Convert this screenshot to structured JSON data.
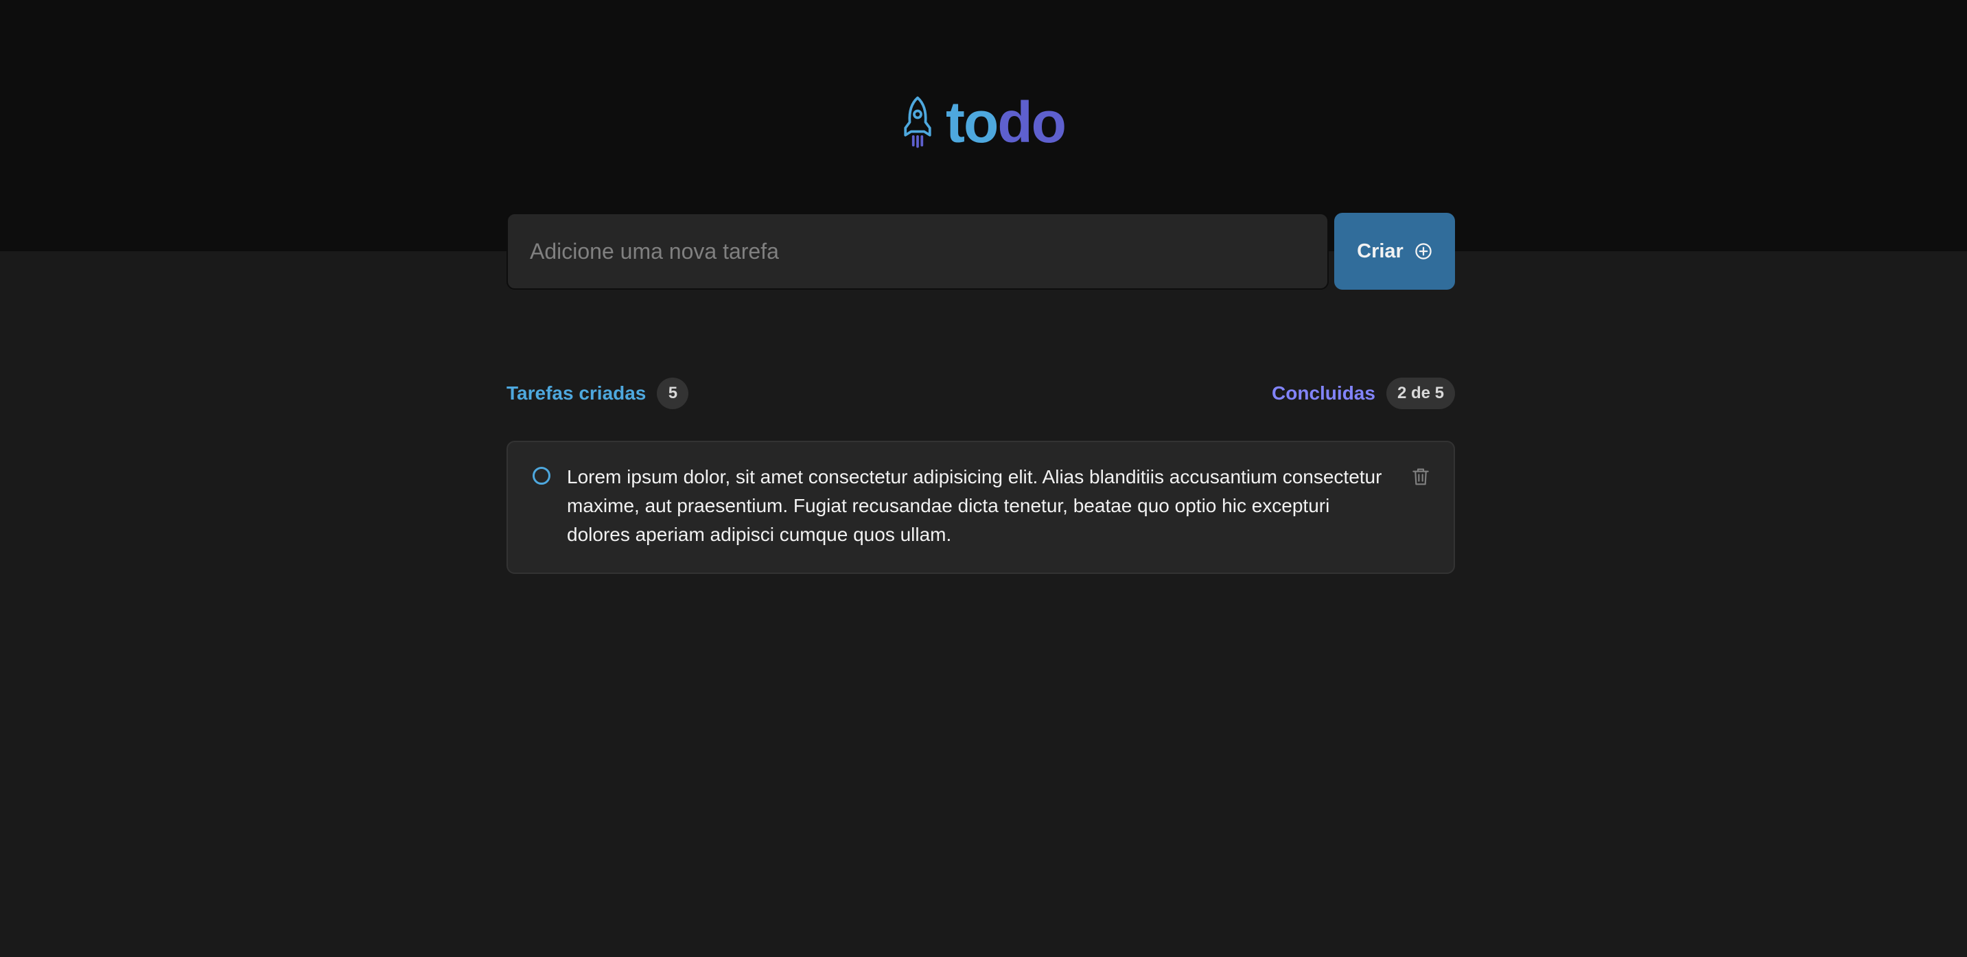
{
  "brand": {
    "part1": "to",
    "part2": "do",
    "icon": "rocket-icon"
  },
  "new_task": {
    "placeholder": "Adicione uma nova tarefa",
    "value": "",
    "button_label": "Criar",
    "button_icon": "plus-circle-icon"
  },
  "info": {
    "created_label": "Tarefas criadas",
    "created_count": "5",
    "done_label": "Concluidas",
    "done_count": "2 de 5"
  },
  "tasks": [
    {
      "text": "Lorem ipsum dolor, sit amet consectetur adipisicing elit. Alias blanditiis accusantium consectetur maxime, aut praesentium. Fugiat recusandae dicta tenetur, beatae quo optio hic excepturi dolores aperiam adipisci cumque quos ullam.",
      "completed": false
    }
  ],
  "colors": {
    "blue": "#4ea8de",
    "purple": "#5e60ce",
    "purple_light": "#8284fa",
    "button": "#316d9b",
    "header_bg": "#0d0d0d",
    "page_bg": "#1a1a1a"
  }
}
